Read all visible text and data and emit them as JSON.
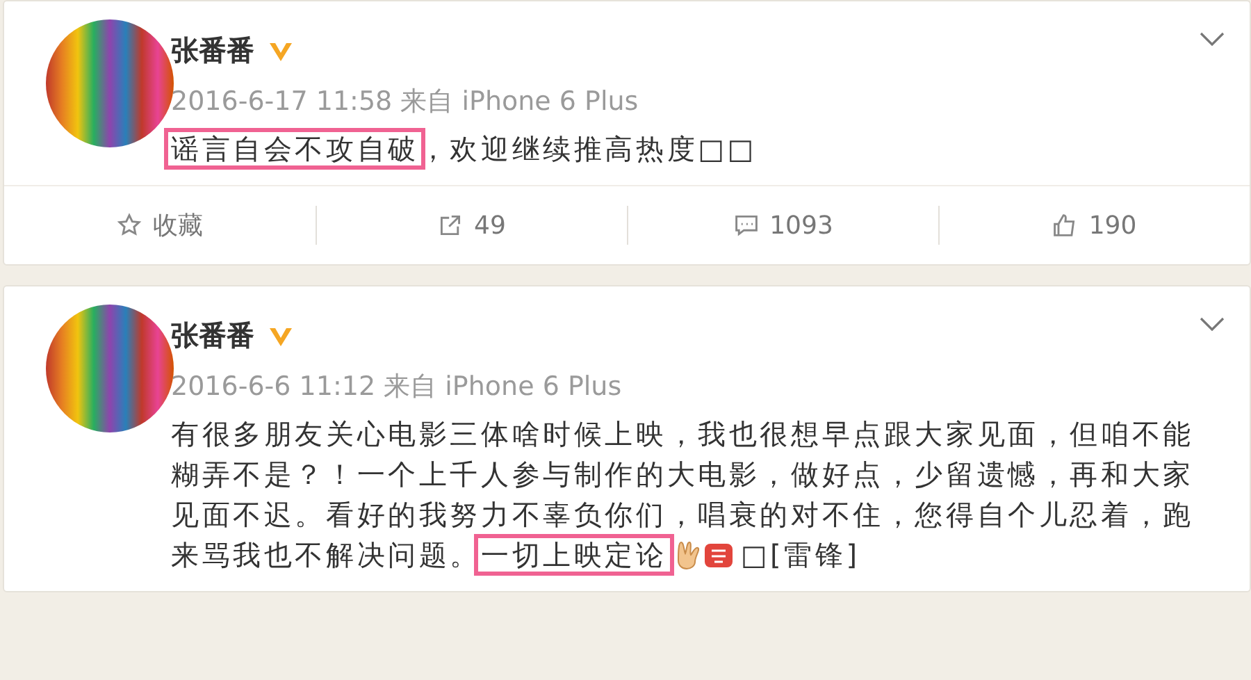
{
  "posts": [
    {
      "author": "张番番",
      "verified": true,
      "time": "2016-6-17 11:58",
      "source_prefix": "来自",
      "source": "iPhone 6 Plus",
      "lines": [
        [
          {
            "kind": "text",
            "text": "谣言自会不攻自破",
            "highlighted": true
          },
          {
            "kind": "text",
            "text": "，欢迎继续推高热度□□",
            "highlighted": false
          }
        ]
      ],
      "actions": [
        {
          "kind": "star",
          "label": "收藏"
        },
        {
          "kind": "share",
          "label": "49"
        },
        {
          "kind": "comment",
          "label": "1093"
        },
        {
          "kind": "like",
          "label": "190"
        }
      ]
    },
    {
      "author": "张番番",
      "verified": true,
      "time": "2016-6-6 11:12",
      "source_prefix": "来自",
      "source": "iPhone 6 Plus",
      "lines": [
        [
          {
            "kind": "text",
            "text": "有很多朋友关心电影三体啥时候上映，我也很想早点跟大家见面，但咱不能",
            "highlighted": false
          }
        ],
        [
          {
            "kind": "text",
            "text": "糊弄不是？！一个上千人参与制作的大电影，做好点，少留遗憾，再和大家",
            "highlighted": false
          }
        ],
        [
          {
            "kind": "text",
            "text": "见面不迟。看好的我努力不辜负你们，唱衰的对不住，您得自个儿忍着，跑",
            "highlighted": false
          }
        ],
        [
          {
            "kind": "text",
            "text": "来骂我也不解决问题。",
            "highlighted": false
          },
          {
            "kind": "text",
            "text": "一切上映定论",
            "highlighted": true
          },
          {
            "kind": "hand"
          },
          {
            "kind": "badge"
          },
          {
            "kind": "text",
            "text": "□[雷锋]",
            "highlighted": false
          }
        ]
      ]
    }
  ]
}
